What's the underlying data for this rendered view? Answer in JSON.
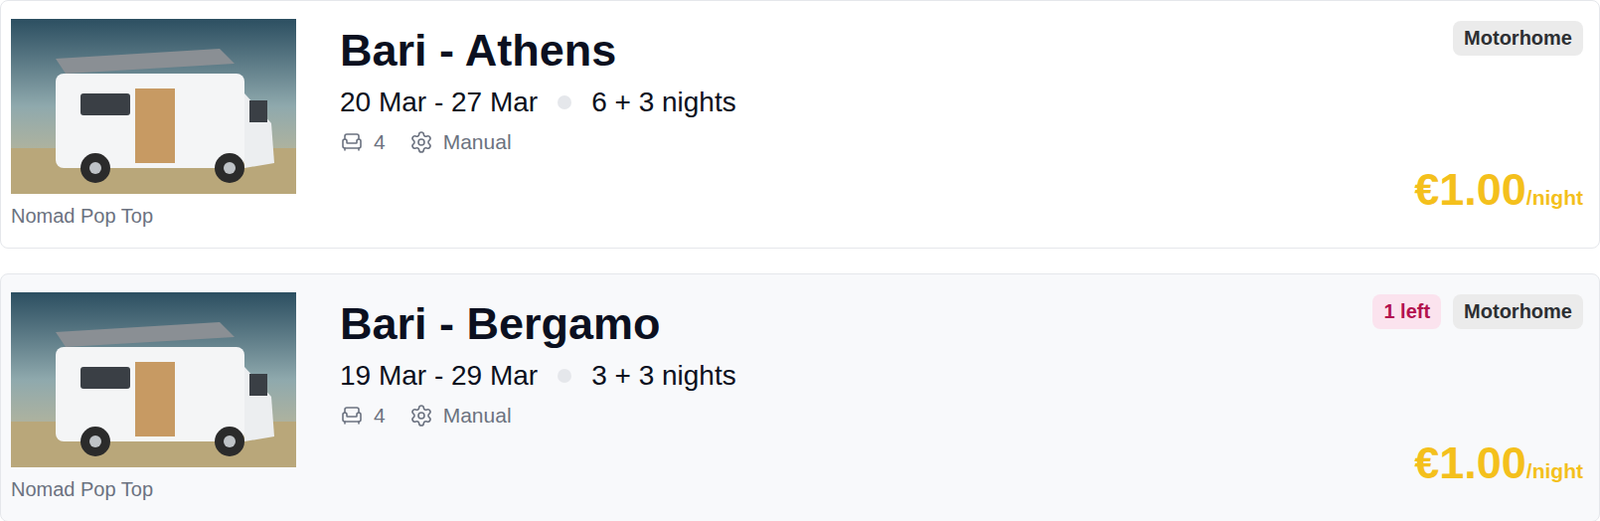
{
  "listings": [
    {
      "route": "Bari - Athens",
      "dates": "20 Mar - 27 Mar",
      "nights": "6 + 3 nights",
      "seats": "4",
      "transmission": "Manual",
      "model": "Nomad Pop Top",
      "badges": [
        {
          "label": "Motorhome",
          "kind": "type"
        }
      ],
      "price": "€1.00",
      "unit": "/night",
      "highlighted": false
    },
    {
      "route": "Bari - Bergamo",
      "dates": "19 Mar - 29 Mar",
      "nights": "3 + 3 nights",
      "seats": "4",
      "transmission": "Manual",
      "model": "Nomad Pop Top",
      "badges": [
        {
          "label": "1 left",
          "kind": "stock"
        },
        {
          "label": "Motorhome",
          "kind": "type"
        }
      ],
      "price": "€1.00",
      "unit": "/night",
      "highlighted": true
    }
  ]
}
